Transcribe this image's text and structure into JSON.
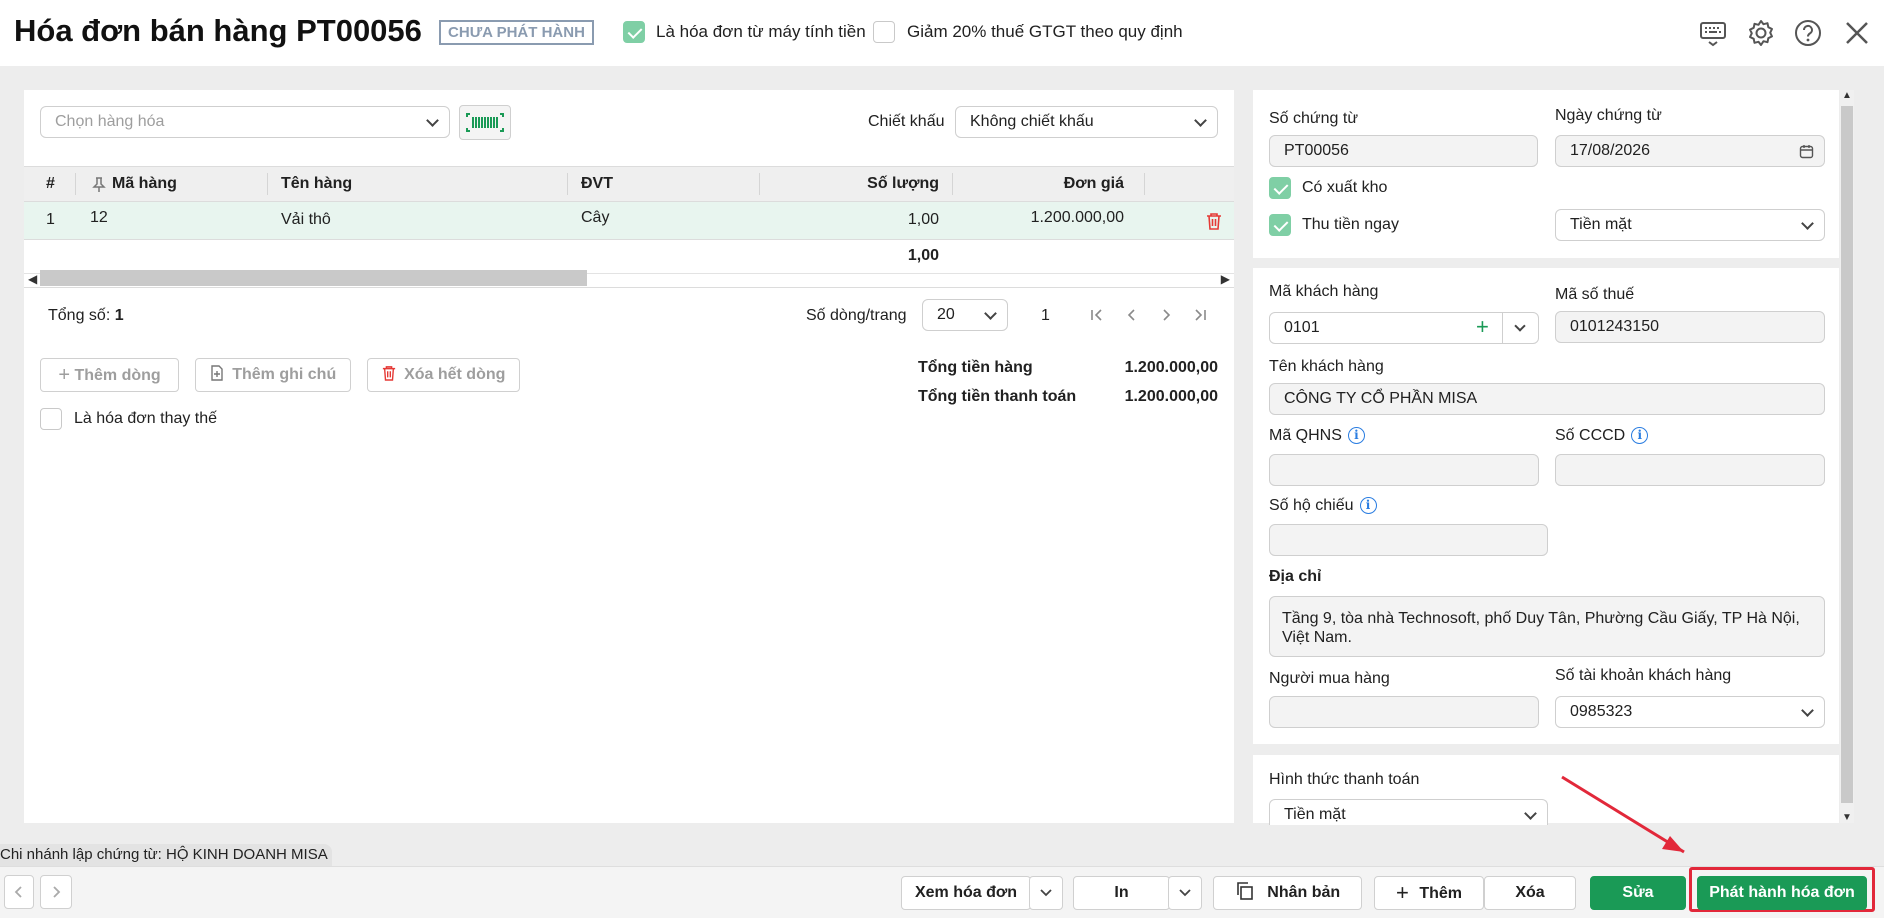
{
  "header": {
    "title": "Hóa đơn bán hàng PT00056",
    "status_badge": "CHƯA PHÁT HÀNH",
    "cash_register_label": "Là hóa đơn từ máy tính tiền",
    "cash_register_checked": true,
    "vat_reduce_label": "Giảm 20% thuế GTGT theo quy định",
    "vat_reduce_checked": false
  },
  "items": {
    "product_placeholder": "Chọn hàng hóa",
    "discount_label": "Chiết khấu",
    "discount_value": "Không chiết khấu",
    "columns": [
      "#",
      "Mã hàng",
      "Tên hàng",
      "ĐVT",
      "Số lượng",
      "Đơn giá"
    ],
    "rows": [
      {
        "no": "1",
        "code": "12",
        "name": "Vải thô",
        "unit": "Cây",
        "qty": "1,00",
        "price": "1.200.000,00"
      }
    ],
    "qty_total": "1,00",
    "total_count_label": "Tổng số:",
    "total_count": "1",
    "rows_per_page_label": "Số dòng/trang",
    "rows_per_page": "20",
    "page": "1",
    "add_row": "Thêm dòng",
    "add_note": "Thêm ghi chú",
    "delete_all": "Xóa hết dòng",
    "replacement_label": "Là hóa đơn thay thế",
    "subtotal_label": "Tổng tiền hàng",
    "subtotal_value": "1.200.000,00",
    "payment_total_label": "Tổng tiền thanh toán",
    "payment_total_value": "1.200.000,00"
  },
  "voucher": {
    "number_label": "Số chứng từ",
    "number": "PT00056",
    "date_label": "Ngày chứng từ",
    "date": "17/08/2026",
    "export_label": "Có xuất kho",
    "collect_label": "Thu tiền ngay",
    "collect_method": "Tiền mặt"
  },
  "customer": {
    "code_label": "Mã khách hàng",
    "code": "0101",
    "tax_label": "Mã số thuế",
    "tax": "0101243150",
    "name_label": "Tên khách hàng",
    "name": "CÔNG TY CỔ PHẦN MISA",
    "qhns_label": "Mã QHNS",
    "cccd_label": "Số CCCD",
    "passport_label": "Số hộ chiếu",
    "address_label": "Địa chỉ",
    "address": "Tầng 9, tòa nhà Technosoft, phố Duy Tân, Phường Cầu Giấy, TP Hà Nội, Việt Nam.",
    "buyer_label": "Người mua hàng",
    "account_label": "Số tài khoản khách hàng",
    "account": "0985323"
  },
  "payment": {
    "method_label": "Hình thức thanh toán",
    "method": "Tiền mặt"
  },
  "footer": {
    "branch": "Chi nhánh lập chứng từ: HỘ KINH DOANH MISA",
    "view_invoice": "Xem hóa đơn",
    "print": "In",
    "duplicate": "Nhân bản",
    "add": "Thêm",
    "delete": "Xóa",
    "edit": "Sửa",
    "issue": "Phát hành hóa đơn"
  },
  "colors": {
    "primary": "#1a9a56",
    "highlight": "#e2283a"
  }
}
